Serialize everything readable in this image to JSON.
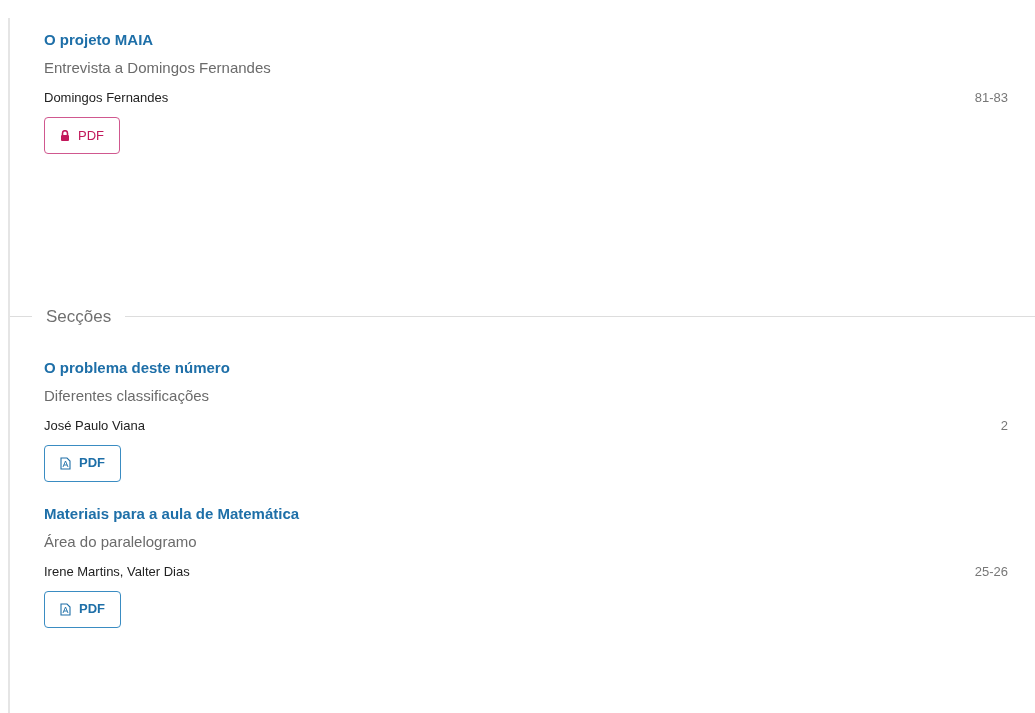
{
  "sections": [
    {
      "articles": [
        {
          "title": "O projeto MAIA",
          "subtitle": "Entrevista a Domingos Fernandes",
          "authors": "Domingos Fernandes",
          "pages": "81-83",
          "galley": {
            "label": "PDF",
            "kind": "locked"
          }
        }
      ]
    },
    {
      "heading": "Secções",
      "articles": [
        {
          "title": "O problema deste número",
          "subtitle": "Diferentes classificações",
          "authors": "José Paulo Viana",
          "pages": "2",
          "galley": {
            "label": "PDF",
            "kind": "open"
          }
        },
        {
          "title": "Materiais para a aula de Matemática",
          "subtitle": "Área do paralelogramo",
          "authors": "Irene Martins, Valter Dias",
          "pages": "25-26",
          "galley": {
            "label": "PDF",
            "kind": "open"
          }
        }
      ]
    }
  ]
}
